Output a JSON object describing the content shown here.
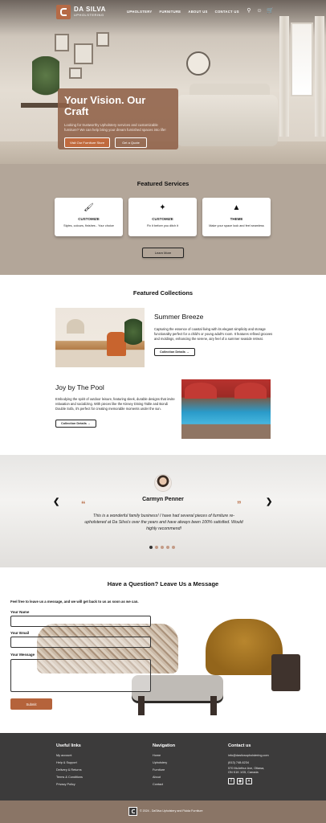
{
  "nav": {
    "brand_name": "DA SILVA",
    "brand_sub": "UPHOLSTERING",
    "links": [
      "UPHOLSTERY",
      "FURNITURE",
      "ABOUT US",
      "CONTACT US"
    ],
    "icons": [
      "search-icon",
      "account-icon",
      "cart-icon"
    ]
  },
  "hero": {
    "title": "Your Vision. Our Craft",
    "text": "Looking for trustworthy Upholstery services and customizable furniture? We can help bring your dream furnished spaces into life!",
    "primary_button": "Visit Our Furniture Store",
    "secondary_button": "Get a Quote"
  },
  "services": {
    "title": "Featured Services",
    "items": [
      {
        "icon": "brush-icon",
        "title": "CUSTOMIZE",
        "desc": "Styles, colours, finishes - Your choice"
      },
      {
        "icon": "puzzle-icon",
        "title": "CUSTOMIZE",
        "desc": "Fix it before you ditch it"
      },
      {
        "icon": "shapes-icon",
        "title": "THEME",
        "desc": "Make your space look and feel seamless"
      }
    ],
    "button": "Learn More"
  },
  "collections": {
    "title": "Featured Collections",
    "items": [
      {
        "title": "Summer Breeze",
        "text": "Capturing the essence of coastal living with its elegant simplicity and storage functionality perfect for a child's or young adult's room. It features refined grooves and moldings, enhancing the serene, airy feel of a summer seaside retreat.",
        "button": "Collection Details"
      },
      {
        "title": "Joy by The Pool",
        "text": "Embodying the spirit of outdoor leisure, featuring sleek, durable designs that invite relaxation and socializing. With pieces like the Kinsey Dining Table and Bondi Double Sofa, it's perfect for creating memorable moments under the sun.",
        "button": "Collection Details"
      }
    ]
  },
  "testimonial": {
    "name": "Carmyn Penner",
    "quote": "This is a wonderful family business!  I have had several pieces of furniture  re-upholstered at Da Silva's over the years and have always been 100% satisfied.  Would highly recommend!",
    "open_quote": "“",
    "close_quote": "”",
    "prev": "❮",
    "next": "❯",
    "dots_total": 5,
    "dots_active": 1
  },
  "contact": {
    "title": "Have a Question? Leave Us a Message",
    "intro": "Feel free to leave us a message, and we will get back to us as soon as we can.",
    "name_label": "Your Name",
    "email_label": "Your Email",
    "message_label": "Your Message",
    "submit": "Submit"
  },
  "footer": {
    "useful_title": "Useful links",
    "useful_links": [
      "My account",
      "Help & Support",
      "Delivery & Returns",
      "Terms & Conditions",
      "Privacy Policy"
    ],
    "nav_title": "Navigation",
    "nav_links": [
      "Home",
      "Upholstery",
      "Furniture",
      "About",
      "Contact"
    ],
    "contact_title": "Contact us",
    "email": "info@dasilvaupholstering.com",
    "phone": "(613) 748-6234",
    "address_line1": "570 McArthur Ave, Ottawa,",
    "address_line2": "ON K1K 1G5, Canada",
    "social": [
      "facebook-icon",
      "instagram-icon",
      "x-icon"
    ],
    "copyright": "© 2024 - DaSilva Upholstery and Fluida Furniture"
  },
  "colors": {
    "accent": "#b5633b",
    "hero_card": "#8f6148",
    "services_bg": "#b3a699",
    "footer_bg": "#3c3b3b",
    "bottom_bar": "#8a7566"
  }
}
